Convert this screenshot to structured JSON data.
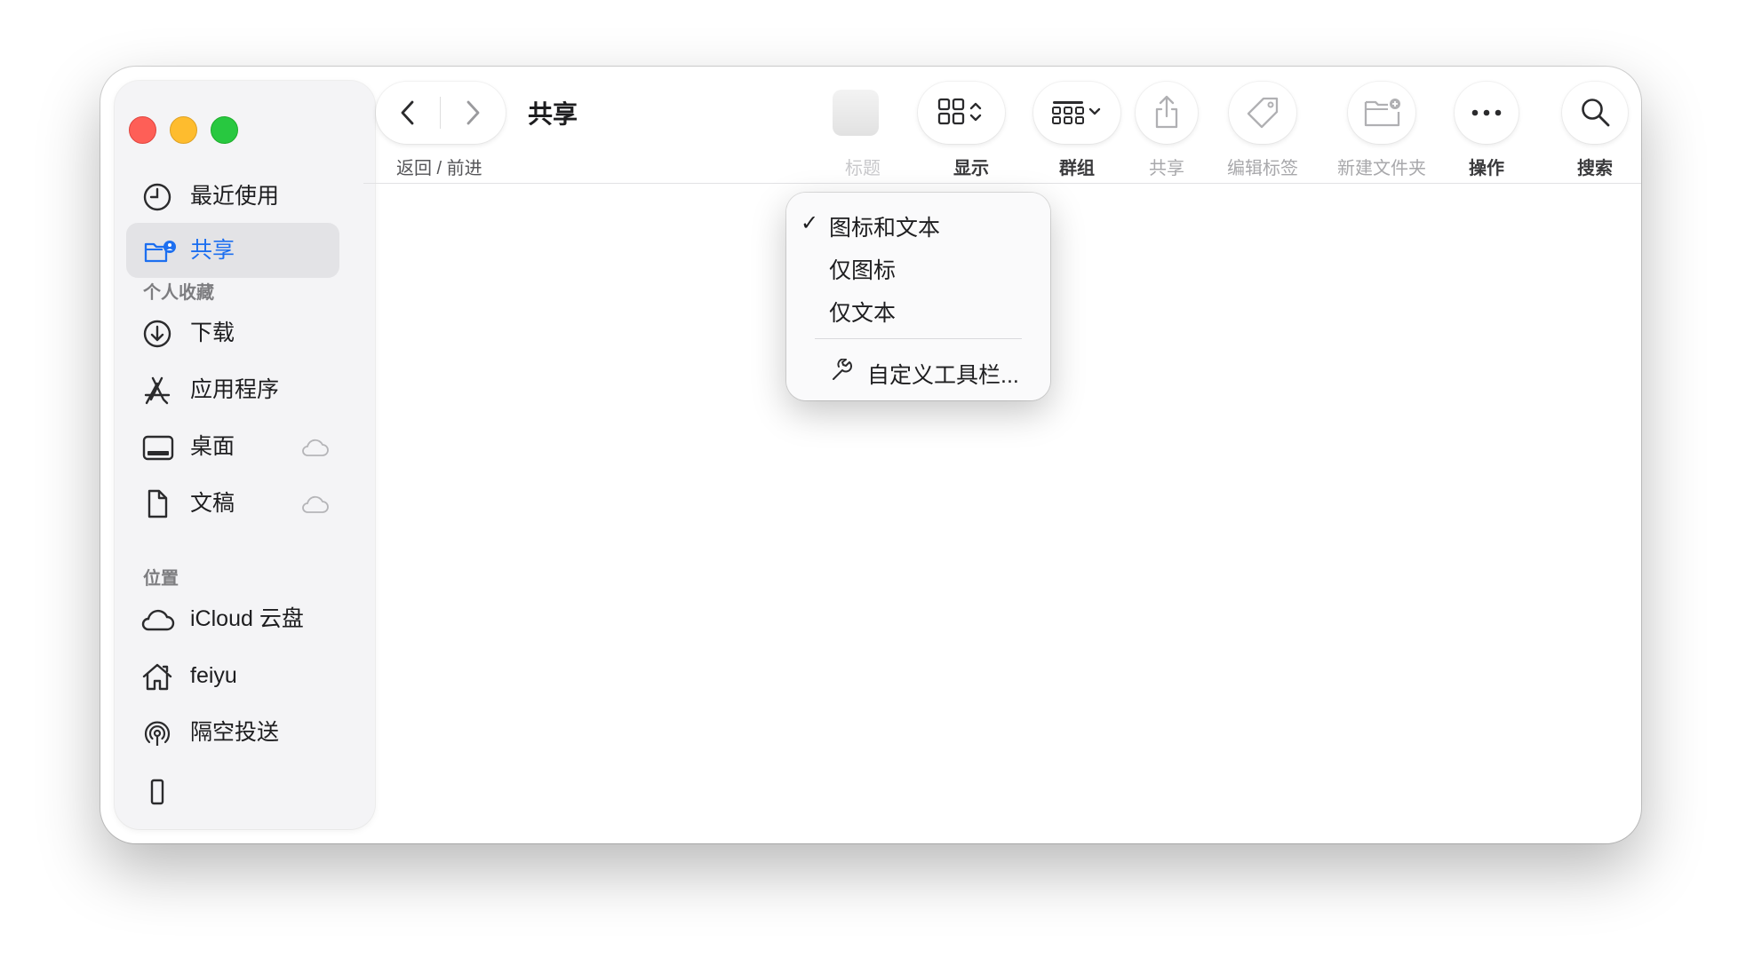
{
  "window": {
    "title": "共享"
  },
  "toolbar": {
    "nav_label": "返回 / 前进",
    "view_label": "显示",
    "group_label": "群组",
    "share_label": "共享",
    "tags_label": "编辑标签",
    "new_folder_label": "新建文件夹",
    "action_label": "操作",
    "search_label": "搜索",
    "ghost_label": "标题"
  },
  "sidebar": {
    "top_items": [
      {
        "label": "最近使用",
        "icon": "clock-icon"
      },
      {
        "label": "共享",
        "icon": "shared-folder-icon",
        "selected": true
      }
    ],
    "favorites_header": "个人收藏",
    "favorites": [
      {
        "label": "下载",
        "icon": "download-icon"
      },
      {
        "label": "应用程序",
        "icon": "applications-icon"
      },
      {
        "label": "桌面",
        "icon": "desktop-icon",
        "cloud": true
      },
      {
        "label": "文稿",
        "icon": "document-icon",
        "cloud": true
      }
    ],
    "locations_header": "位置",
    "locations": [
      {
        "label": "iCloud 云盘",
        "icon": "icloud-icon"
      },
      {
        "label": "feiyu",
        "icon": "home-icon"
      },
      {
        "label": "隔空投送",
        "icon": "airdrop-icon"
      }
    ]
  },
  "context_menu": {
    "items": [
      {
        "label": "图标和文本",
        "checked": true
      },
      {
        "label": "仅图标",
        "checked": false
      },
      {
        "label": "仅文本",
        "checked": false
      }
    ],
    "customize": "自定义工具栏..."
  },
  "colors": {
    "accent": "#1d6ff0",
    "close": "#fe5f57",
    "minimize": "#febc2e",
    "maximize": "#28c840"
  }
}
